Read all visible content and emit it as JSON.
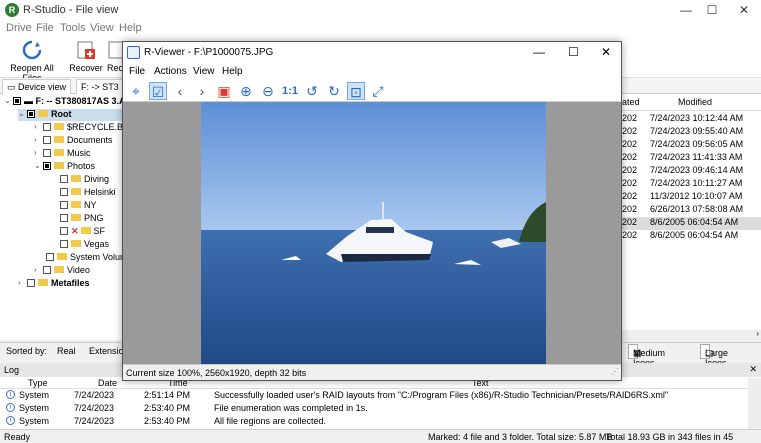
{
  "app": {
    "title": "R-Studio - File view",
    "min": "—",
    "max": "☐",
    "close": "✕"
  },
  "menu": [
    "Drive",
    "File",
    "Tools",
    "View",
    "Help"
  ],
  "toolbar": {
    "reopen": "Reopen All Files",
    "recover": "Recover",
    "reco": "Reco"
  },
  "tabs": {
    "device": "Device view",
    "file": "F: -> ST3"
  },
  "tree": {
    "drive": "F: -- ST380817AS 3.A",
    "root": "Root",
    "items": [
      "$RECYCLE.BIN",
      "Documents",
      "Music",
      "Photos",
      "Diving",
      "Helsinki",
      "NY",
      "PNG",
      "SF",
      "Vegas",
      "System Volum",
      "Video",
      "Metafiles"
    ]
  },
  "list": {
    "col_created": "ated",
    "col_modified": "Modified",
    "rows": [
      {
        "c": "202",
        "m": "7/24/2023 10:12:44 AM"
      },
      {
        "c": "202",
        "m": "7/24/2023 09:55:40 AM"
      },
      {
        "c": "202",
        "m": "7/24/2023 09:56:05 AM"
      },
      {
        "c": "202",
        "m": "7/24/2023 11:41:33 AM"
      },
      {
        "c": "202",
        "m": "7/24/2023 09:46:14 AM"
      },
      {
        "c": "202",
        "m": "7/24/2023 10:11:27 AM"
      },
      {
        "c": "202",
        "m": "11/3/2012 10:10:07 AM"
      },
      {
        "c": "202",
        "m": "6/26/2013 07:58:08 AM"
      },
      {
        "c": "202",
        "m": "8/6/2005 06:04:54 AM"
      },
      {
        "c": "202",
        "m": "8/6/2005 06:04:54 AM"
      }
    ]
  },
  "sortbar": {
    "label": "Sorted by:",
    "real": "Real",
    "ext": "Extensio",
    "medium": "Medium Icons",
    "large": "Large Icons"
  },
  "log": {
    "title": "Log",
    "cols": {
      "type": "Type",
      "date": "Date",
      "time": "Time",
      "text": "Text"
    },
    "rows": [
      {
        "type": "System",
        "date": "7/24/2023",
        "time": "2:51:14 PM",
        "text": "Successfully loaded user's RAID layouts from \"C:/Program Files (x86)/R-Studio Technician/Presets/RAID6RS.xml\""
      },
      {
        "type": "System",
        "date": "7/24/2023",
        "time": "2:53:40 PM",
        "text": "File enumeration was completed in 1s."
      },
      {
        "type": "System",
        "date": "7/24/2023",
        "time": "2:53:40 PM",
        "text": "All file regions are collected."
      }
    ]
  },
  "status": {
    "ready": "Ready",
    "marked": "Marked: 4 file and 3 folder. Total size: 5.87 MB",
    "total": "Total 18.93 GB in 343 files in 45 folders"
  },
  "viewer": {
    "title": "R-Viewer - F:\\P1000075.JPG",
    "menu": [
      "File",
      "Actions",
      "View",
      "Help"
    ],
    "zoom_label": "1:1",
    "status": "Current size 100%, 2560x1920, depth 32 bits"
  }
}
